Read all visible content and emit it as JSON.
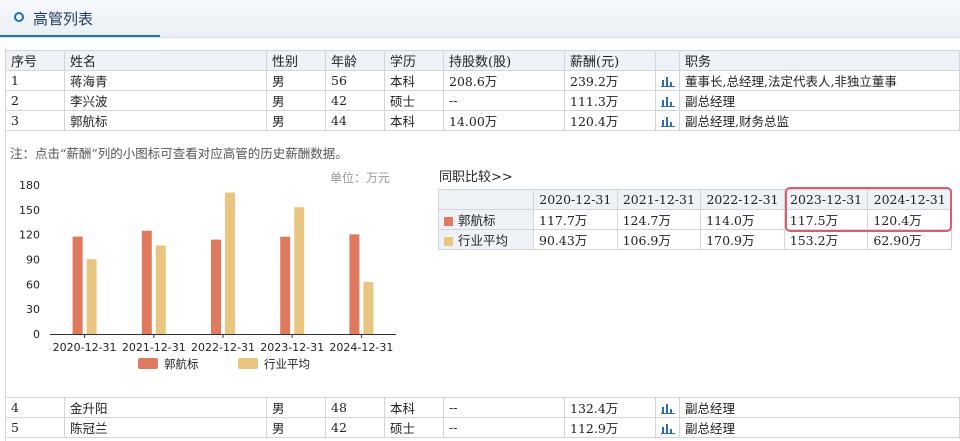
{
  "header": {
    "title": "高管列表"
  },
  "table": {
    "columns": [
      "序号",
      "姓名",
      "性别",
      "年龄",
      "学历",
      "持股数(股)",
      "薪酬(元)",
      "",
      "职务"
    ],
    "top_rows": [
      {
        "no": "1",
        "name": "蒋海青",
        "gender": "男",
        "age": "56",
        "edu": "本科",
        "shares": "208.6万",
        "salary": "239.2万",
        "role": "董事长,总经理,法定代表人,非独立董事"
      },
      {
        "no": "2",
        "name": "李兴波",
        "gender": "男",
        "age": "42",
        "edu": "硕士",
        "shares": "--",
        "salary": "111.3万",
        "role": "副总经理"
      },
      {
        "no": "3",
        "name": "郭航标",
        "gender": "男",
        "age": "44",
        "edu": "本科",
        "shares": "14.00万",
        "salary": "120.4万",
        "role": "副总经理,财务总监"
      }
    ],
    "bottom_rows": [
      {
        "no": "4",
        "name": "金升阳",
        "gender": "男",
        "age": "48",
        "edu": "本科",
        "shares": "--",
        "salary": "132.4万",
        "role": "副总经理"
      },
      {
        "no": "5",
        "name": "陈冠兰",
        "gender": "男",
        "age": "42",
        "edu": "硕士",
        "shares": "--",
        "salary": "112.9万",
        "role": "副总经理"
      }
    ]
  },
  "note": "注：点击“薪酬”列的小图标可查看对应高管的历史薪酬数据。",
  "unit_label": "单位：万元",
  "comparison": {
    "title": "同职比较>>",
    "years": [
      "2020-12-31",
      "2021-12-31",
      "2022-12-31",
      "2023-12-31",
      "2024-12-31"
    ],
    "rows": [
      {
        "label": "郭航标",
        "color": "#e07a5f",
        "values": [
          "117.7万",
          "124.7万",
          "114.0万",
          "117.5万",
          "120.4万"
        ]
      },
      {
        "label": "行业平均",
        "color": "#eac57f",
        "values": [
          "90.43万",
          "106.9万",
          "170.9万",
          "153.2万",
          "62.90万"
        ]
      }
    ]
  },
  "chart_data": {
    "type": "bar",
    "categories": [
      "2020-12-31",
      "2021-12-31",
      "2022-12-31",
      "2023-12-31",
      "2024-12-31"
    ],
    "series": [
      {
        "name": "郭航标",
        "color": "#e07a5f",
        "values": [
          117.7,
          124.7,
          114.0,
          117.5,
          120.4
        ]
      },
      {
        "name": "行业平均",
        "color": "#eac57f",
        "values": [
          90.43,
          106.9,
          170.9,
          153.2,
          62.9
        ]
      }
    ],
    "ylim": [
      0,
      180
    ],
    "yticks": [
      0,
      30,
      60,
      90,
      120,
      150,
      180
    ],
    "legend": "bottom",
    "grid": false
  }
}
